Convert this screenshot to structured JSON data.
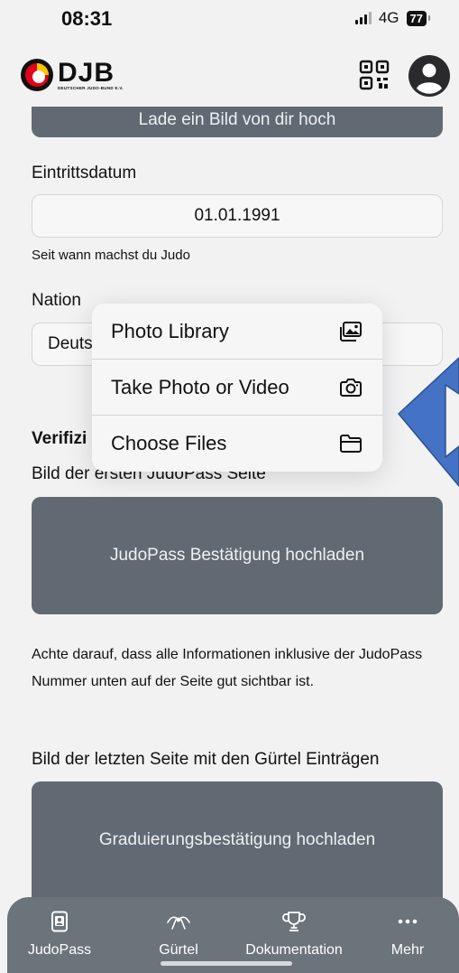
{
  "status": {
    "time": "08:31",
    "network": "4G",
    "battery": "77"
  },
  "header": {
    "logo_text": "DJB",
    "logo_subtitle": "DEUTSCHER JUDO-BUND E.V."
  },
  "profile_upload": {
    "label": "Lade ein Bild von dir hoch"
  },
  "entry_date": {
    "label": "Eintrittsdatum",
    "value": "01.01.1991",
    "hint": "Seit wann machst du Judo"
  },
  "nation": {
    "label": "Nation",
    "value_visible": "Deuts"
  },
  "verification": {
    "heading_visible": "Verifizi",
    "first_page_label": "Bild der ersten JudoPass Seite",
    "judopass_upload": "JudoPass Bestätigung hochladen",
    "note": "Achte darauf, dass alle Informationen inklusive der JudoPass Nummer unten auf der Seite gut sichtbar ist.",
    "last_page_label": "Bild der letzten Seite mit den Gürtel Einträgen",
    "grade_upload": "Graduierungsbestätigung hochladen"
  },
  "picker_menu": {
    "items": [
      {
        "label": "Photo Library",
        "icon": "photo-library-icon"
      },
      {
        "label": "Take Photo or Video",
        "icon": "camera-icon"
      },
      {
        "label": "Choose Files",
        "icon": "folder-icon"
      }
    ]
  },
  "tabbar": {
    "items": [
      {
        "label": "JudoPass",
        "icon": "id-card-icon"
      },
      {
        "label": "Gürtel",
        "icon": "belt-icon"
      },
      {
        "label": "Dokumentation",
        "icon": "trophy-icon"
      },
      {
        "label": "Mehr",
        "icon": "more-icon"
      }
    ]
  },
  "colors": {
    "upload_button": "#616a73",
    "tabbar": "#6b737b",
    "arrow": "#4472c4",
    "logo_red": "#e3001b",
    "logo_yellow": "#f7c600"
  }
}
